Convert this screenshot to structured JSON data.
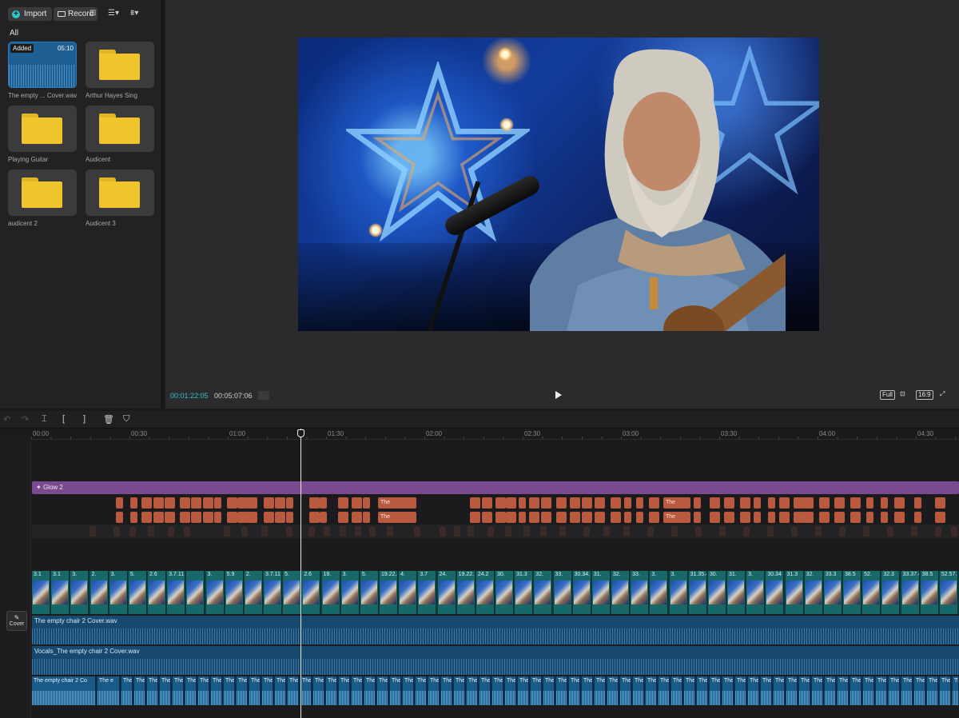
{
  "media": {
    "import_label": "Import",
    "record_label": "Record",
    "filter_all": "All",
    "items": [
      {
        "name": "The empty ... Cover.wav",
        "type": "audio",
        "badge": "Added",
        "duration": "05:10"
      },
      {
        "name": "Arthur Hayes Sing",
        "type": "folder"
      },
      {
        "name": "Playing Guitar",
        "type": "folder"
      },
      {
        "name": "Audicent",
        "type": "folder"
      },
      {
        "name": "audicent 2",
        "type": "folder"
      },
      {
        "name": "Audicent 3",
        "type": "folder"
      }
    ]
  },
  "player": {
    "current_time": "00:01:22:05",
    "total_time": "00:05:07:06",
    "full_label": "Full",
    "ratio_label": "16:9"
  },
  "timeline": {
    "ruler_labels": [
      "00:00",
      "00:30",
      "01:00",
      "01:30",
      "02:00",
      "02:30",
      "03:00",
      "03:30",
      "04:00",
      "04:30"
    ],
    "effect_label": "Glow 2",
    "cover_label": "Cover",
    "audio_tracks": [
      {
        "name": "The empty chair 2 Cover.wav"
      },
      {
        "name": "Vocals_The empty chair 2 Cover.wav"
      }
    ],
    "split_audio_first": "The empty chair 2 Co",
    "split_audio_short": "The e",
    "sticker_text": "The",
    "clip_labels": [
      "3.1",
      "3.1",
      "3.",
      "2.",
      "3.",
      "5.",
      "2.6",
      "3.7.11.",
      "",
      "3.",
      "5.9",
      "2.",
      "3.7.11",
      "5.",
      "2.6",
      "19.",
      "3.",
      "5.",
      "19.22.2",
      "4.",
      "3.7",
      "24.",
      "19.22.",
      "24.2",
      "30.",
      "31.3",
      "32.",
      "33.",
      "30.34.",
      "31.",
      "32.",
      "33.",
      "3.",
      "3.",
      "31.35.4",
      "30.",
      "31.",
      "3.",
      "30.34",
      "31.3",
      "32.",
      "33.3",
      "38.5",
      "52.",
      "32.3",
      "33.37.4",
      "38.5",
      "52.57."
    ]
  },
  "colors": {
    "accent": "#35bcc8",
    "effect": "#7a4a8f",
    "sticker": "#b95a3e",
    "video_track": "#176868",
    "audio_track": "#17496f",
    "folder": "#f0c52c"
  },
  "icons": [
    "plus-icon",
    "camera-icon",
    "grid-icon",
    "sort-icon",
    "filter-icon",
    "play-icon",
    "fullscreen-icon",
    "zoom-icon",
    "undo-icon",
    "redo-icon",
    "split-icon",
    "trim-left-icon",
    "trim-right-icon",
    "delete-icon",
    "shield-icon",
    "pen-icon",
    "sparkle-icon"
  ]
}
